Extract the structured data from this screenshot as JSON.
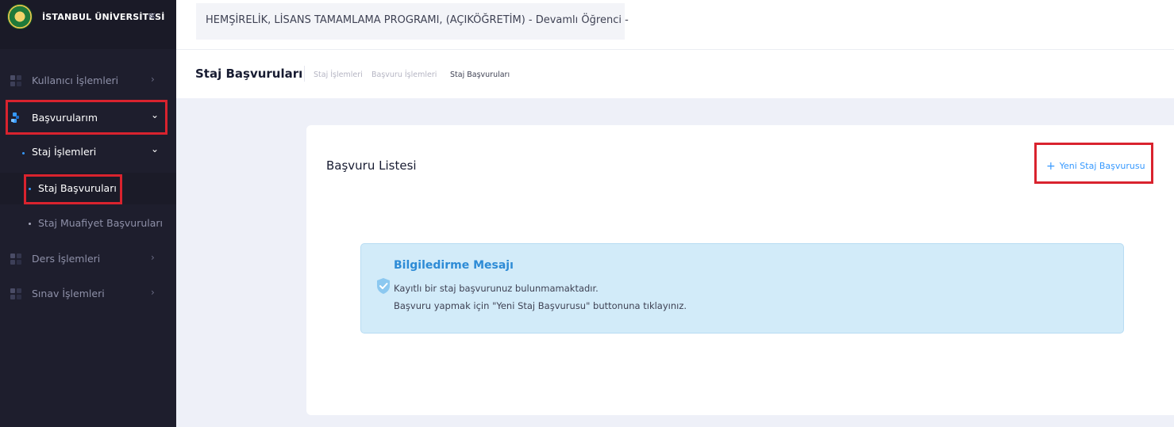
{
  "brand": {
    "name": "İSTANBUL ÜNİVERSİTESİ",
    "toggle_icon": "double-chevron-left-icon"
  },
  "sidebar": {
    "items": [
      {
        "label": "Kullanıcı İşlemleri",
        "arrow": "›"
      },
      {
        "label": "Başvurularım",
        "arrow": "⌄"
      },
      {
        "label": "Staj İşlemleri",
        "arrow": "⌄"
      },
      {
        "label": "Staj Başvuruları"
      },
      {
        "label": "Staj Muafiyet Başvuruları"
      },
      {
        "label": "Ders İşlemleri",
        "arrow": "›"
      },
      {
        "label": "Sınav İşlemleri",
        "arrow": "›"
      }
    ]
  },
  "header": {
    "title": "HEMŞİRELİK, LİSANS TAMAMLAMA PROGRAMI, (AÇIKÖĞRETİM) - Devamlı Öğrenci -"
  },
  "subheader": {
    "title": "Staj Başvuruları",
    "breadcrumbs": [
      "Staj İşlemleri",
      "Başvuru İşlemleri",
      "Staj Başvuruları"
    ]
  },
  "card": {
    "title": "Başvuru Listesi",
    "new_button": {
      "icon": "+",
      "label": "Yeni Staj Başvurusu"
    }
  },
  "info": {
    "title": "Bilgiledirme Mesajı",
    "line1": "Kayıtlı bir staj başvurunuz bulunmamaktadır.",
    "line2": "Başvuru yapmak için \"Yeni Staj Başvurusu\" buttonuna tıklayınız."
  },
  "colors": {
    "sidebar_bg": "#1e1e2d",
    "accent": "#3699ff",
    "highlight": "#d9232e",
    "info_bg": "#d2ebf9"
  }
}
